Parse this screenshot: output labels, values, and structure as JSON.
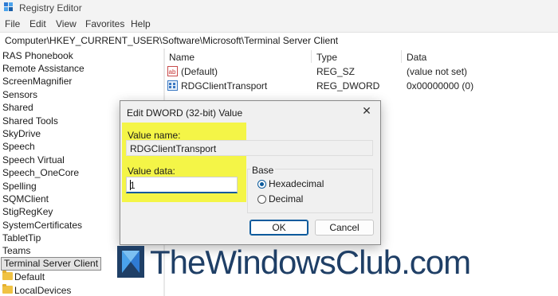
{
  "window": {
    "title": "Registry Editor",
    "icon": "registry-editor-icon"
  },
  "menu": [
    "File",
    "Edit",
    "View",
    "Favorites",
    "Help"
  ],
  "address": {
    "path": "Computer\\HKEY_CURRENT_USER\\Software\\Microsoft\\Terminal Server Client"
  },
  "tree": {
    "items": [
      "RAS Phonebook",
      "Remote Assistance",
      "ScreenMagnifier",
      "Sensors",
      "Shared",
      "Shared Tools",
      "SkyDrive",
      "Speech",
      "Speech Virtual",
      "Speech_OneCore",
      "Spelling",
      "SQMClient",
      "StigRegKey",
      "SystemCertificates",
      "TabletTip",
      "Teams"
    ],
    "selected": "Terminal Server Client",
    "children": [
      "Default",
      "LocalDevices"
    ]
  },
  "list": {
    "headers": {
      "name": "Name",
      "type": "Type",
      "data": "Data"
    },
    "rows": [
      {
        "name": "(Default)",
        "type": "REG_SZ",
        "data": "(value not set)",
        "icon": "string-value-icon"
      },
      {
        "name": "RDGClientTransport",
        "type": "REG_DWORD",
        "data": "0x00000000 (0)",
        "icon": "dword-value-icon"
      }
    ]
  },
  "dialog": {
    "title": "Edit DWORD (32-bit) Value",
    "value_name_label": "Value name:",
    "value_name": "RDGClientTransport",
    "value_data_label": "Value data:",
    "value_data": "1",
    "base_label": "Base",
    "hex_label": "Hexadecimal",
    "dec_label": "Decimal",
    "selected_base": "Hexadecimal",
    "ok_label": "OK",
    "cancel_label": "Cancel",
    "highlight_color": "#f4f547"
  },
  "watermark": {
    "text": "TheWindowsClub.com",
    "color": "#1f3f66"
  },
  "colors": {
    "accent": "#0a5a9c"
  }
}
